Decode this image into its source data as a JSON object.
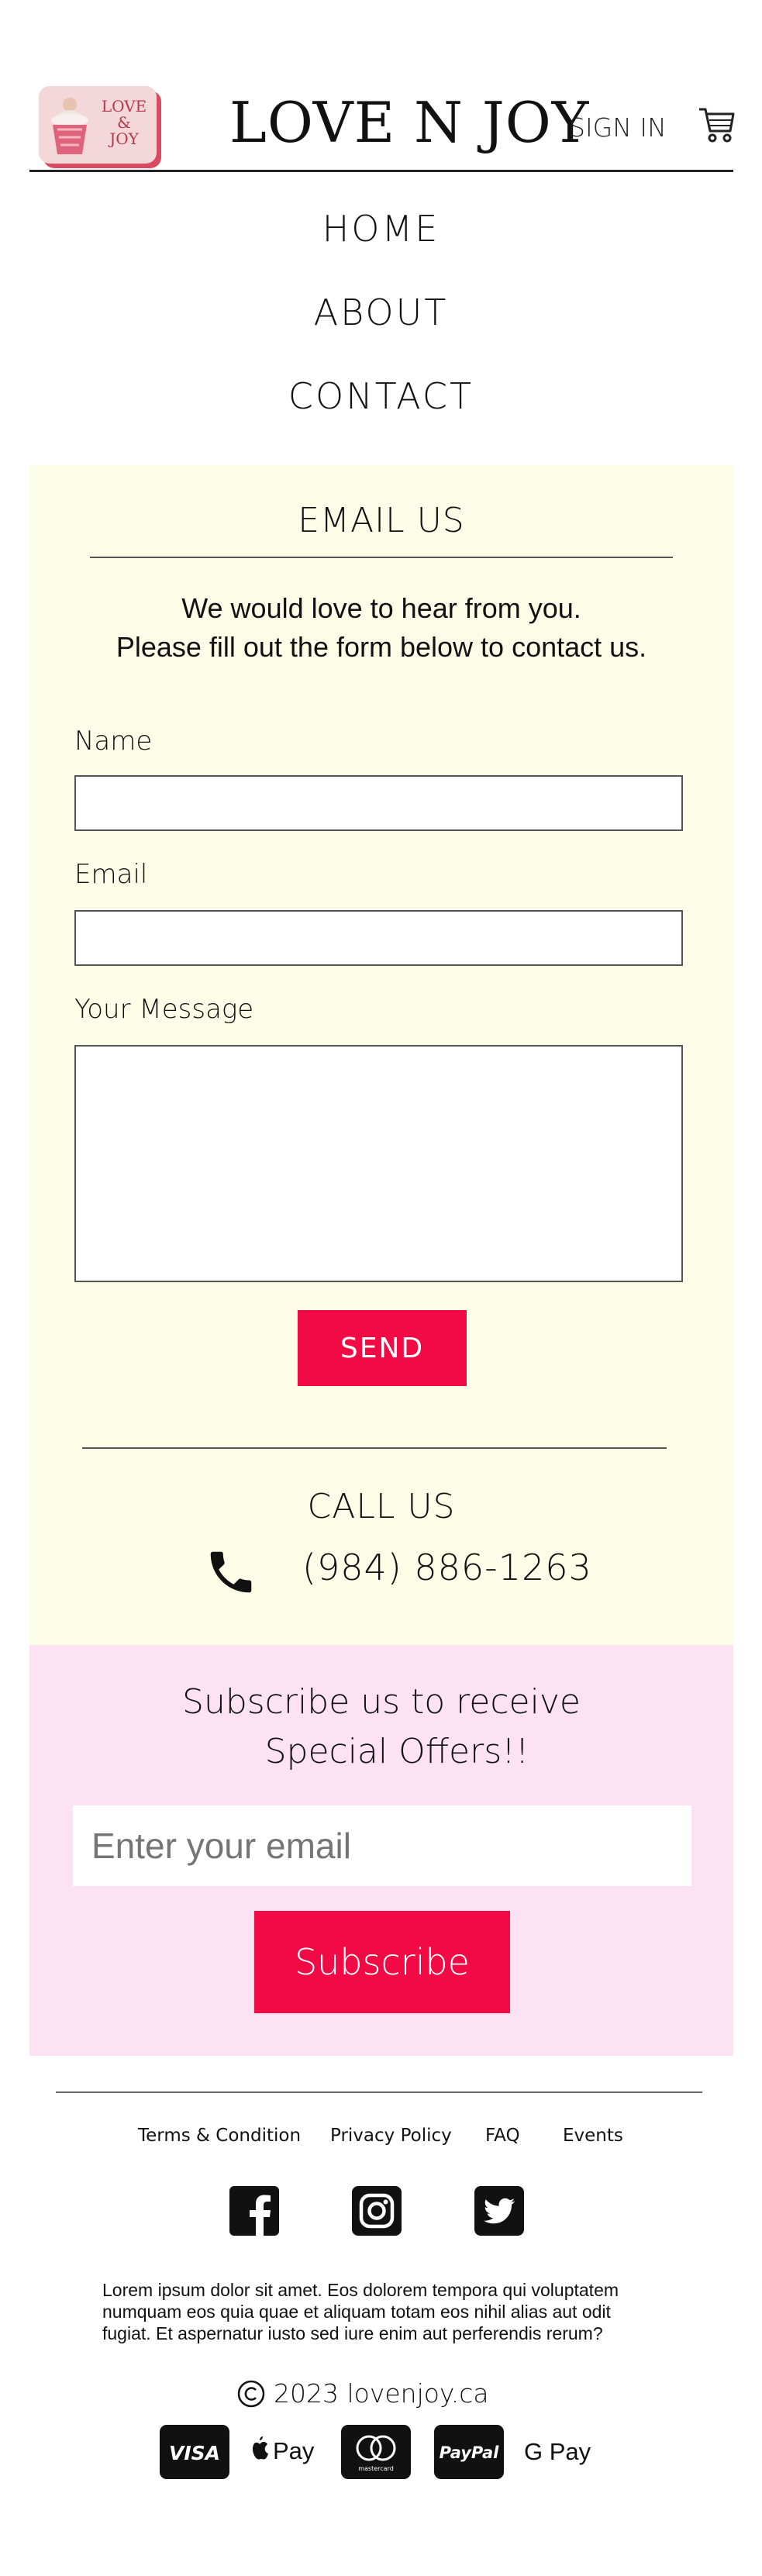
{
  "header": {
    "logo": {
      "line1": "LOVE",
      "line2": "&",
      "line3": "JOY"
    },
    "brand": "LOVE N JOY",
    "signin": "SIGN IN"
  },
  "nav": [
    "HOME",
    "ABOUT",
    "CONTACT"
  ],
  "email_section": {
    "title": "EMAIL US",
    "intro_line1": "We would love to hear from you.",
    "intro_line2": "Please fill out the form below to contact us.",
    "name_label": "Name",
    "name_value": "",
    "email_label": "Email",
    "email_value": "",
    "message_label": "Your Message",
    "message_value": "",
    "send_label": "SEND"
  },
  "call_section": {
    "title": "CALL US",
    "phone": "(984) 886-1263"
  },
  "subscribe": {
    "title_line1": "Subscribe us to receive",
    "title_line2": "Special Offers!!",
    "placeholder": "Enter your email",
    "button": "Subscribe"
  },
  "footer": {
    "links": [
      "Terms & Condition",
      "Privacy Policy",
      "FAQ",
      "Events"
    ],
    "social": [
      "facebook-icon",
      "instagram-icon",
      "twitter-icon"
    ],
    "lorem": "Lorem ipsum dolor sit amet. Eos dolorem tempora qui voluptatem numquam eos quia quae et aliquam totam eos nihil alias aut odit fugiat. Et aspernatur iusto sed iure enim aut perferendis rerum?",
    "copyright": "2023 lovenjoy.ca",
    "payments": {
      "visa": "VISA",
      "applepay": "Pay",
      "mastercard": "mastercard",
      "paypal": "PayPal",
      "gpay": "G Pay"
    }
  },
  "colors": {
    "accent": "#f20a45",
    "email_bg": "#fcfde6",
    "subscribe_bg": "#fce2f2"
  }
}
